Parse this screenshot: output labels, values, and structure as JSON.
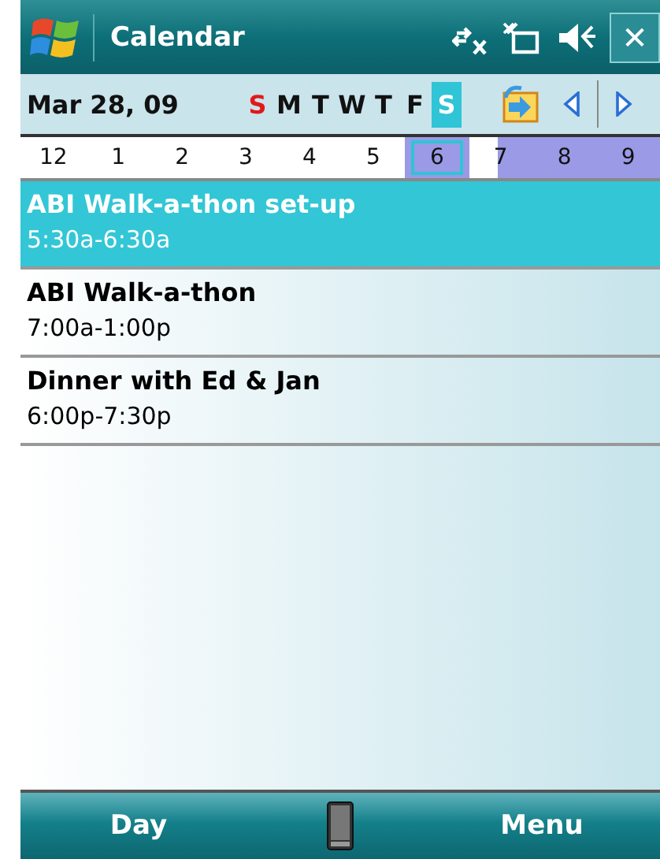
{
  "title_bar": {
    "title": "Calendar",
    "close": "✕"
  },
  "date_bar": {
    "date": "Mar 28, 09",
    "days": [
      {
        "label": "S",
        "selected": false,
        "color": "#e01a1a"
      },
      {
        "label": "M",
        "selected": false,
        "color": "#111111"
      },
      {
        "label": "T",
        "selected": false,
        "color": "#111111"
      },
      {
        "label": "W",
        "selected": false,
        "color": "#111111"
      },
      {
        "label": "T",
        "selected": false,
        "color": "#111111"
      },
      {
        "label": "F",
        "selected": false,
        "color": "#111111"
      },
      {
        "label": "S",
        "selected": true
      }
    ]
  },
  "hours": [
    {
      "label": "12",
      "selected": false,
      "busy": false,
      "partial": false
    },
    {
      "label": "1",
      "selected": false,
      "busy": false,
      "partial": false
    },
    {
      "label": "2",
      "selected": false,
      "busy": false,
      "partial": false
    },
    {
      "label": "3",
      "selected": false,
      "busy": false,
      "partial": false
    },
    {
      "label": "4",
      "selected": false,
      "busy": false,
      "partial": false
    },
    {
      "label": "5",
      "selected": false,
      "busy": false,
      "partial": false
    },
    {
      "label": "6",
      "selected": true,
      "busy": true,
      "partial": false
    },
    {
      "label": "7",
      "selected": false,
      "busy": true,
      "partial": true
    },
    {
      "label": "8",
      "selected": false,
      "busy": true,
      "partial": false
    },
    {
      "label": "9",
      "selected": false,
      "busy": true,
      "partial": false
    }
  ],
  "appointments": [
    {
      "title": "ABI Walk-a-thon set-up",
      "time": "5:30a-6:30a",
      "selected": true
    },
    {
      "title": "ABI Walk-a-thon",
      "time": "7:00a-1:00p",
      "selected": false
    },
    {
      "title": "Dinner with Ed & Jan",
      "time": "6:00p-7:30p",
      "selected": false
    }
  ],
  "soft_keys": {
    "left": "Day",
    "right": "Menu"
  }
}
